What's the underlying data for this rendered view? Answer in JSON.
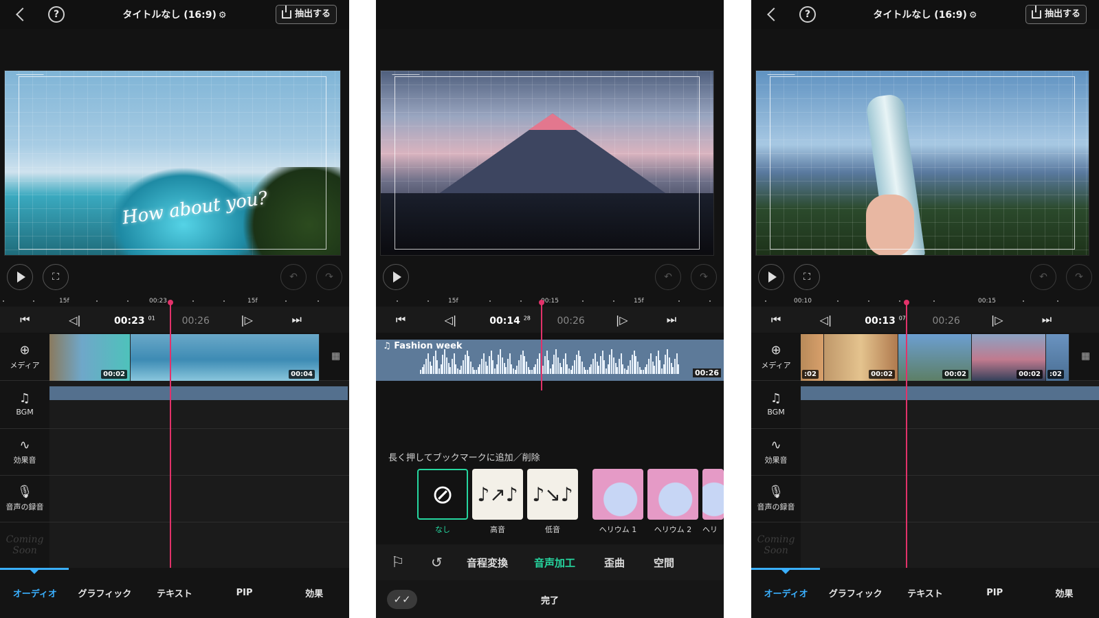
{
  "editor_left": {
    "title": "タイトルなし (16:9)",
    "export_label": "抽出する",
    "preview_caption": "How about you?",
    "ruler": [
      "15f",
      "00:23",
      "15f"
    ],
    "current_time": "00:23",
    "current_frame": "01",
    "total_time": "00:26",
    "clip_times": [
      "00:02",
      "00:04"
    ],
    "track_labels": [
      "メディア",
      "BGM",
      "効果音",
      "音声の録音"
    ],
    "coming_soon": "Coming Soon",
    "tabs": [
      "オーディオ",
      "グラフィック",
      "テキスト",
      "PIP",
      "効果"
    ]
  },
  "voice_fx": {
    "ruler": [
      "15f",
      "00:15",
      "15f"
    ],
    "current_time": "00:14",
    "current_frame": "28",
    "total_time": "00:26",
    "audio_track_title": "Fashion week",
    "audio_track_time": "00:26",
    "hint": "長く押してブックマークに追加／削除",
    "effects": [
      "なし",
      "高音",
      "低音",
      "ヘリウム 1",
      "ヘリウム 2",
      "ヘリ"
    ],
    "categories": [
      "音程変換",
      "音声加工",
      "歪曲",
      "空間"
    ],
    "done_label": "完了"
  },
  "editor_right": {
    "title": "タイトルなし (16:9)",
    "export_label": "抽出する",
    "ruler": [
      "00:10",
      "00:15"
    ],
    "current_time": "00:13",
    "current_frame": "07",
    "total_time": "00:26",
    "clip_times": [
      ":02",
      "00:02",
      "00:02",
      "00:02",
      ":02"
    ],
    "track_labels": [
      "メディア",
      "BGM",
      "効果音",
      "音声の録音"
    ],
    "coming_soon": "Coming Soon",
    "tabs": [
      "オーディオ",
      "グラフィック",
      "テキスト",
      "PIP",
      "効果"
    ]
  },
  "colors": {
    "accent_blue": "#3ab0ff",
    "accent_green": "#26d7a0",
    "playhead": "#e2326a",
    "bgm_track": "#54708e"
  }
}
